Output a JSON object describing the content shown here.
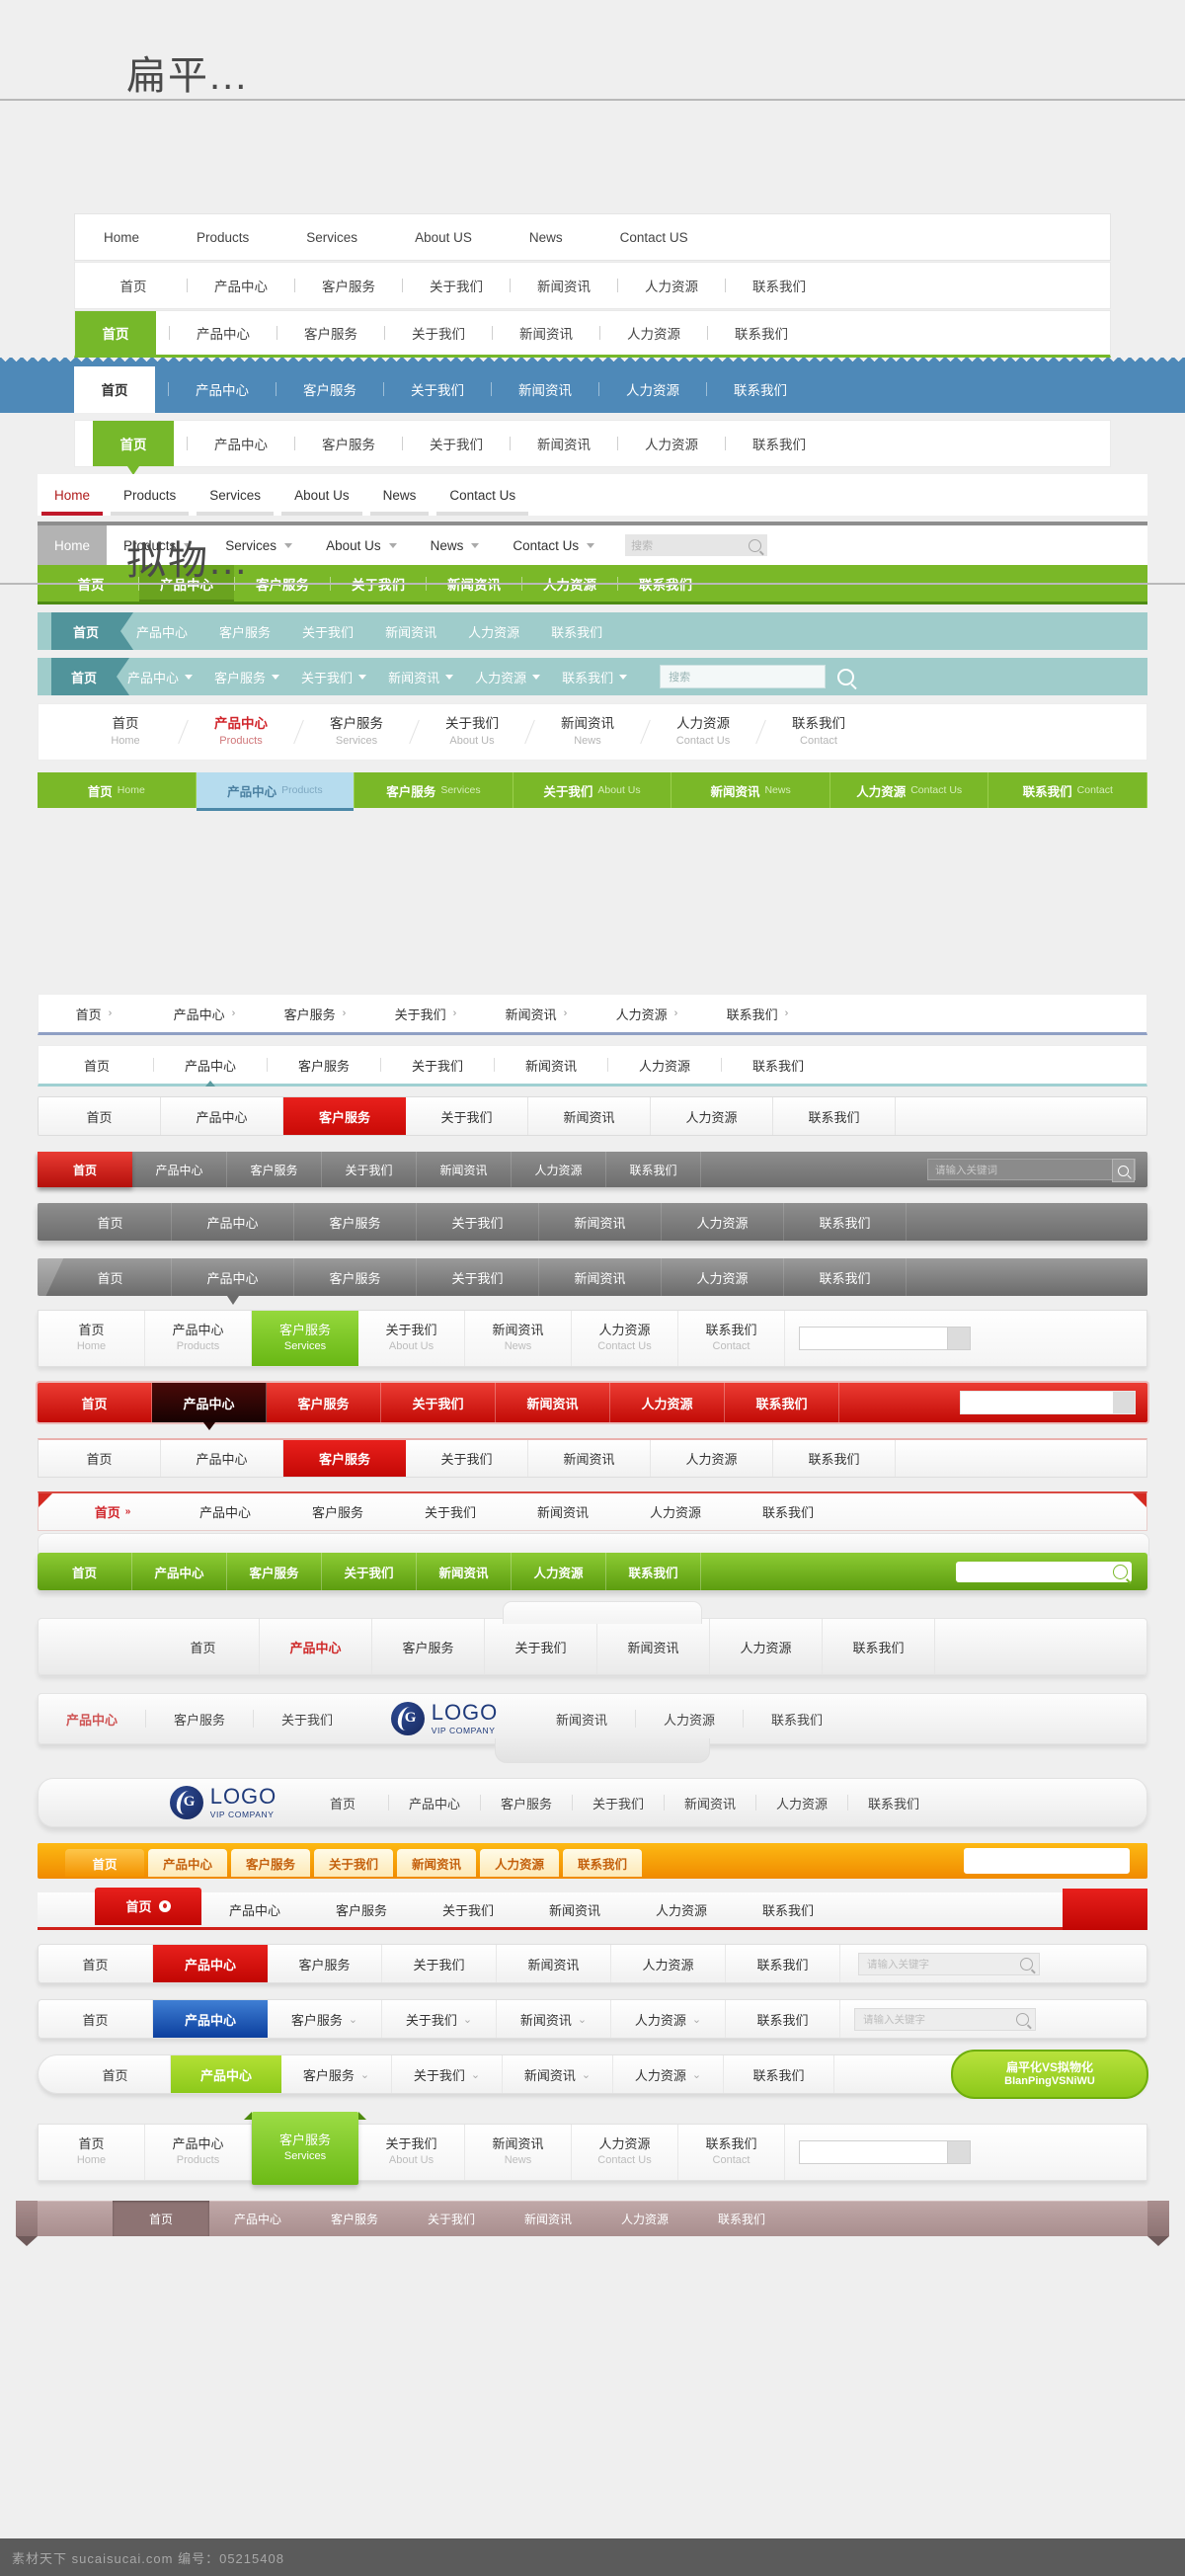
{
  "sections": {
    "flat_title": "扁平...",
    "skeuo_title": "拟物..."
  },
  "menus": {
    "en": [
      "Home",
      "Products",
      "Services",
      "About US",
      "News",
      "Contact US"
    ],
    "en2": [
      "Home",
      "Products",
      "Services",
      "About Us",
      "News",
      "Contact Us"
    ],
    "cn": [
      "首页",
      "产品中心",
      "客户服务",
      "关于我们",
      "新闻资讯",
      "人力资源",
      "联系我们"
    ],
    "cn_en": [
      "Home",
      "Products",
      "Services",
      "About Us",
      "News",
      "Contact Us",
      "Contact"
    ]
  },
  "search": {
    "placeholder_cn_short": "搜索",
    "placeholder_keyword": "请输入关键词",
    "placeholder_keyword2": "请输入关键字",
    "icon": "search-icon"
  },
  "logo": {
    "mark_letter": "G",
    "name": "LOGO",
    "tagline": "VIP COMPANY"
  },
  "badge": {
    "line1": "扁平化VS拟物化",
    "line2": "BIanPingVSNiWU"
  },
  "footer": {
    "text": "素材天下 sucaisucai.com   编号：05215408"
  },
  "colors": {
    "green": "#76b82a",
    "blue": "#4e89b8",
    "teal": "#51949b",
    "red": "#c90a06",
    "orange": "#f39200",
    "mauve": "#a98e8e",
    "logo_blue": "#1f3a7a"
  },
  "icons": {
    "caret_down": "chevron-down-icon",
    "chevron_right": "chevron-right-icon",
    "dot": "dot-icon"
  }
}
